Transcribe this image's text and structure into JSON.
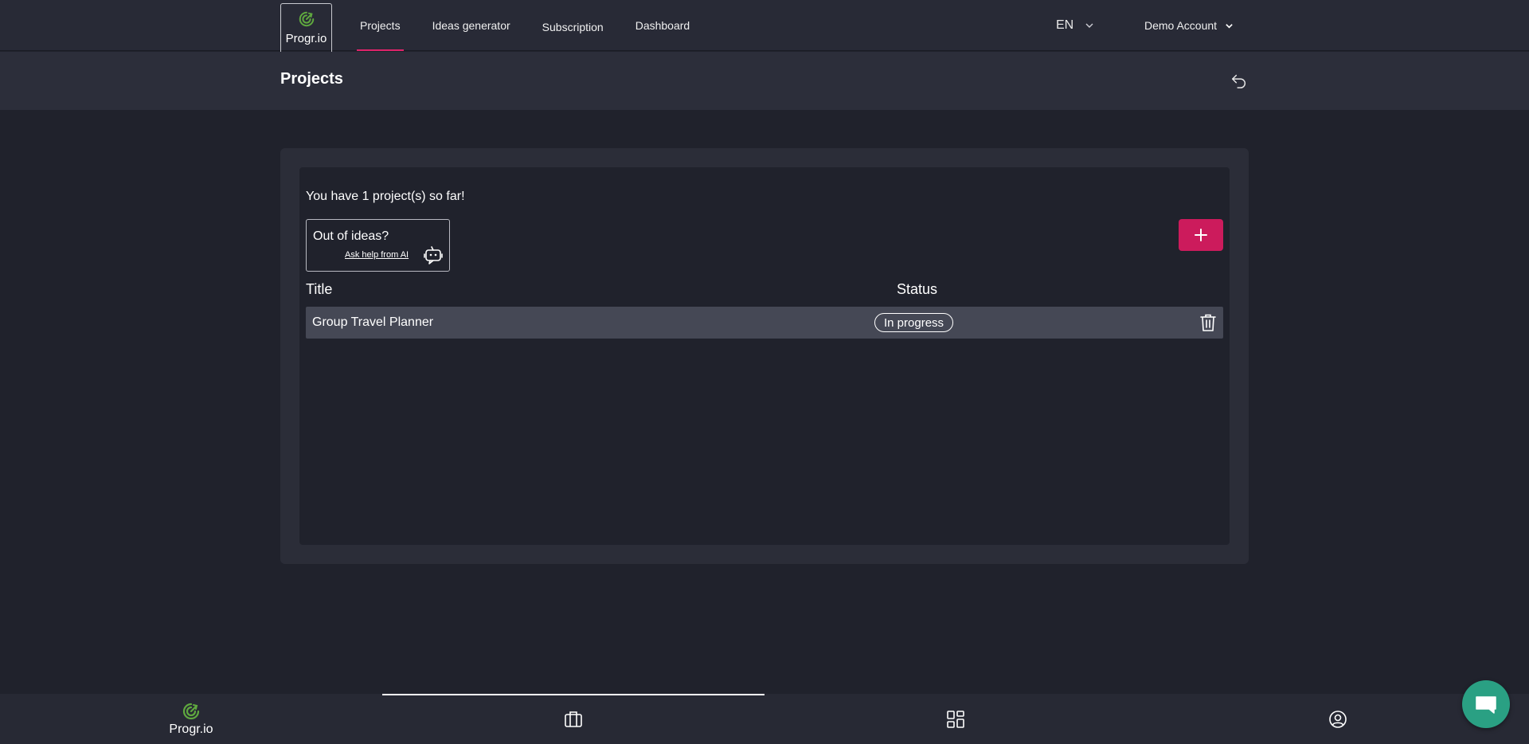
{
  "app": {
    "brand": "Progr.io"
  },
  "nav": {
    "items": [
      {
        "label": "Projects",
        "active": true
      },
      {
        "label": "Ideas generator",
        "active": false
      },
      {
        "label": "Subscription",
        "active": false
      },
      {
        "label": "Dashboard",
        "active": false
      }
    ],
    "language": "EN",
    "account": "Demo Account"
  },
  "page": {
    "title": "Projects"
  },
  "projects": {
    "count_text": "You have 1 project(s) so far!",
    "ideas_title": "Out of ideas?",
    "ideas_link": "Ask help from AI",
    "columns": {
      "title": "Title",
      "status": "Status"
    },
    "rows": [
      {
        "title": "Group Travel Planner",
        "status": "In progress"
      }
    ]
  },
  "bottom_nav": {
    "brand": "Progr.io"
  },
  "colors": {
    "accent": "#cc1b5c",
    "logo_green": "#5fa83f",
    "chat": "#2aa083",
    "background": "#20222c"
  },
  "icons": [
    "logo-icon",
    "chevron-down-icon",
    "undo-icon",
    "robot-chat-icon",
    "plus-icon",
    "trash-icon",
    "briefcase-icon",
    "grid-icon",
    "user-circle-icon",
    "chat-icon"
  ]
}
